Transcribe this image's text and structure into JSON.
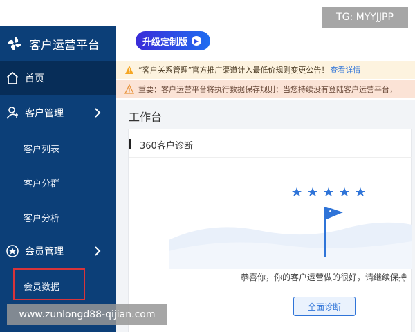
{
  "header": {
    "app_title": "客户运营平台",
    "upgrade_label": "升级定制版"
  },
  "sidebar": {
    "home_label": "首页",
    "groups": [
      {
        "label": "客户管理",
        "items": [
          "客户列表",
          "客户分群",
          "客户分析"
        ]
      },
      {
        "label": "会员管理",
        "items": [
          "会员数据"
        ]
      }
    ]
  },
  "notices": [
    {
      "text": "“客户关系管理”官方推广渠道计入最低价规则变更公告！",
      "link": "查看详情"
    },
    {
      "text": "重要：客户运营平台将执行数据保存规则：当您持续没有登陆客户运营平台，"
    }
  ],
  "workspace": {
    "title": "工作台",
    "card_title": "360客户诊断",
    "message": "恭喜你，你的客户运营做的很好，请继续保持",
    "button_label": "全面诊断"
  },
  "watermarks": {
    "top": "TG: MYYJJPP",
    "bottom": "www.zunlongd88-qijian.com"
  },
  "colors": {
    "sidebar_bg": "#0c3f78",
    "sidebar_active_bg": "#072d58",
    "accent": "#2f74d8",
    "notice_1_bg": "#fdf3df",
    "notice_2_bg": "#fbe3d6",
    "highlight_border": "#d8343a"
  }
}
